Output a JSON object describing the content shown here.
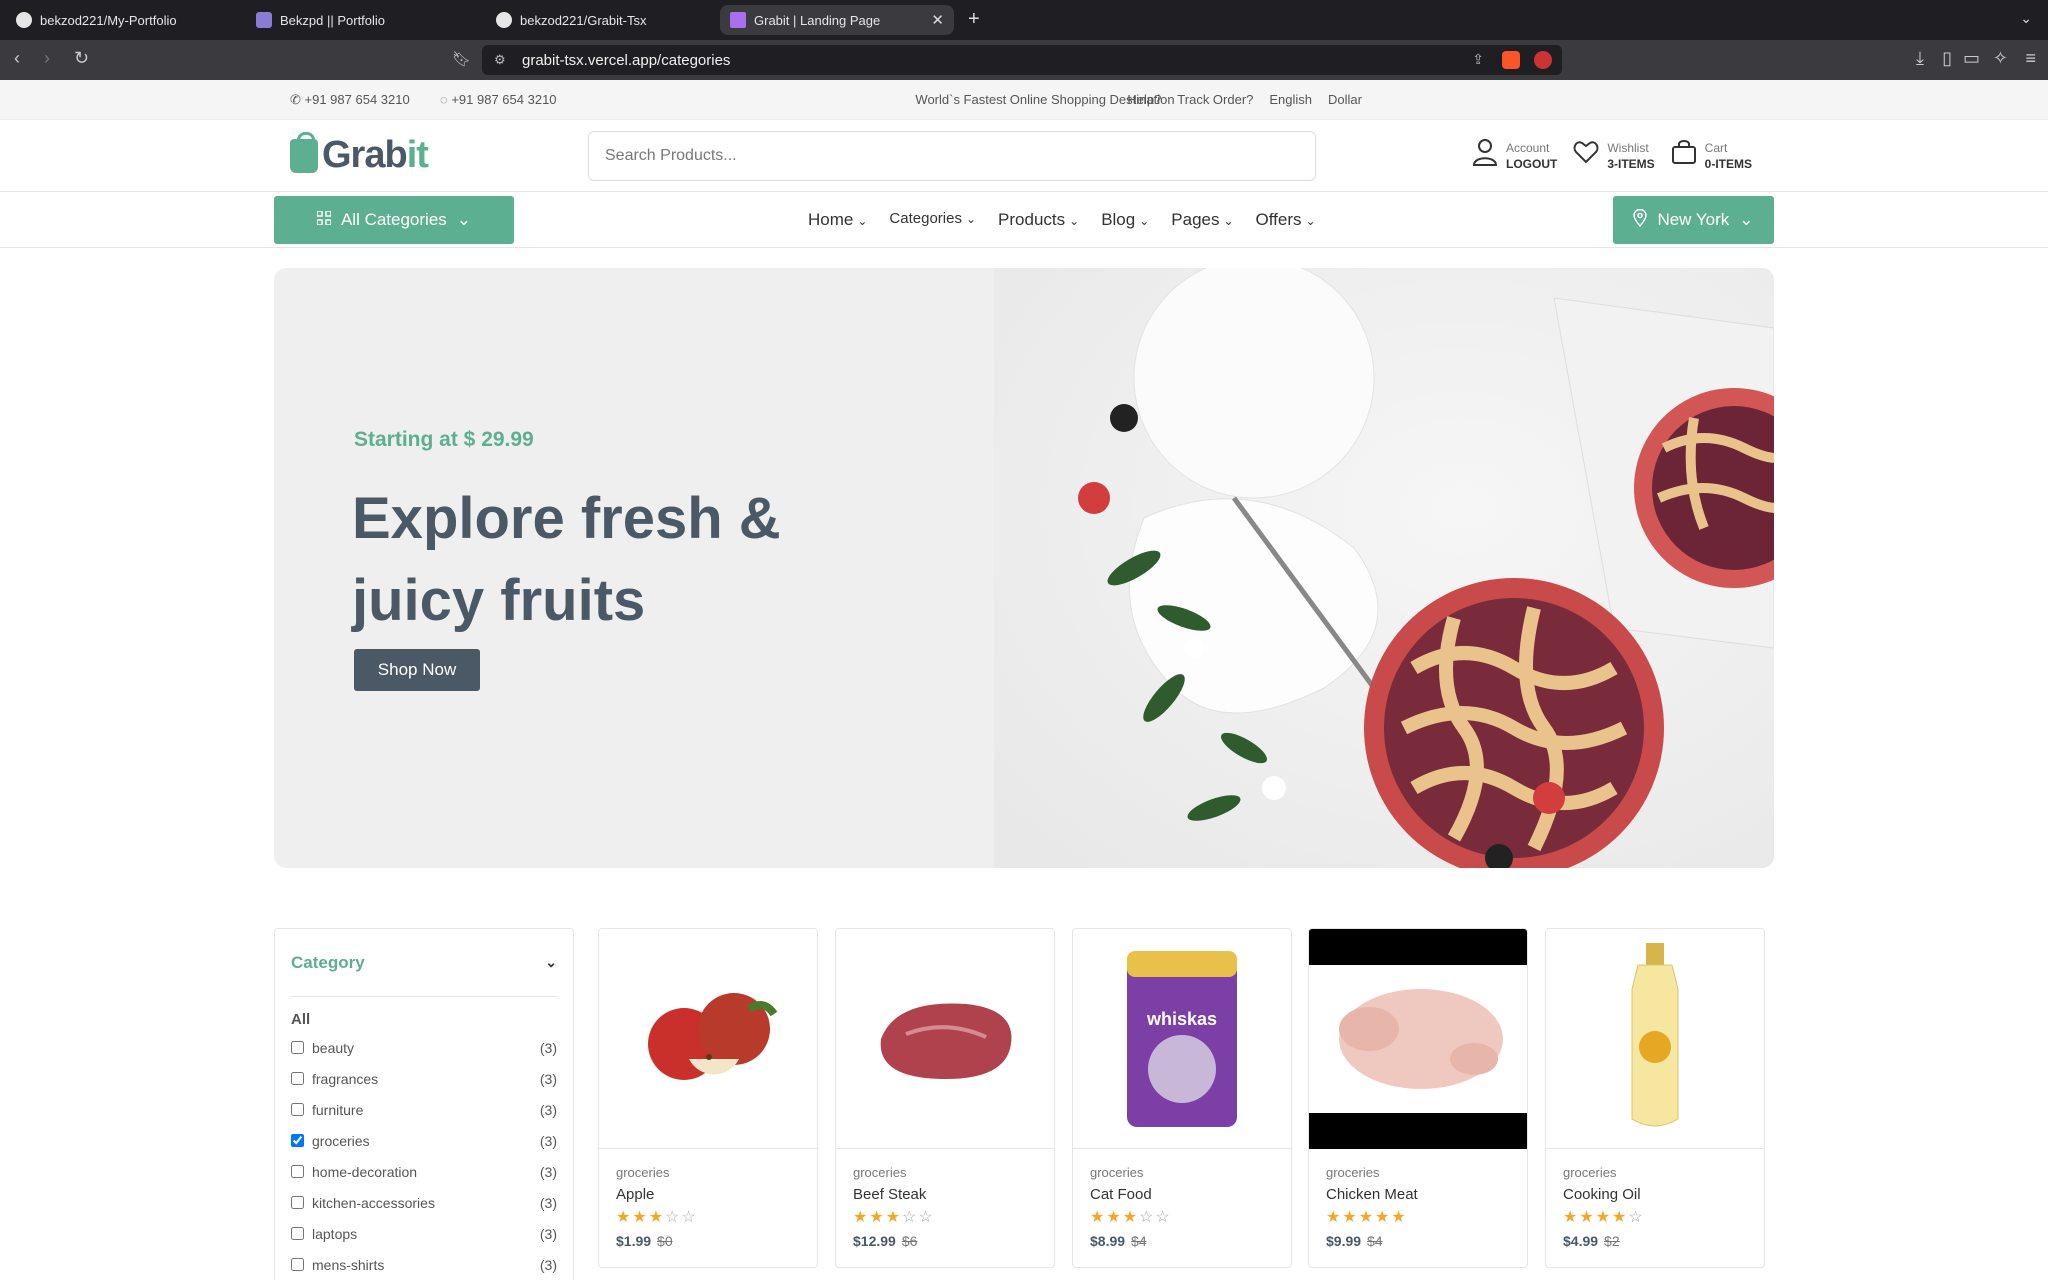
{
  "browser": {
    "tabs": [
      {
        "title": "bekzod221/My-Portfolio"
      },
      {
        "title": "Bekzpd || Portfolio"
      },
      {
        "title": "bekzod221/Grabit-Tsx"
      },
      {
        "title": "Grabit | Landing Page"
      }
    ],
    "url": "grabit-tsx.vercel.app/categories"
  },
  "topstrip": {
    "phone1": "+91 987 654 3210",
    "phone2": "+91 987 654 3210",
    "tagline": "World`s Fastest Online Shopping Destination",
    "links": [
      "Help?",
      "Track Order?",
      "English",
      "Dollar"
    ]
  },
  "header": {
    "logo_text_a": "Grab",
    "logo_text_b": "it",
    "search_placeholder": "Search Products...",
    "account": {
      "label": "Account",
      "value": "LOGOUT"
    },
    "wishlist": {
      "label": "Wishlist",
      "value": "3-ITEMS"
    },
    "cart": {
      "label": "Cart",
      "value": "0-ITEMS"
    }
  },
  "nav": {
    "all_categories": "All Categories",
    "links": [
      "Home",
      "Categories",
      "Products",
      "Blog",
      "Pages",
      "Offers"
    ],
    "city": "New York"
  },
  "hero": {
    "subtitle": "Starting at $ 29.99",
    "title": "Explore fresh & juicy fruits",
    "button": "Shop Now"
  },
  "sidebar": {
    "heading": "Category",
    "all": "All",
    "items": [
      {
        "label": "beauty",
        "count": "(3)",
        "checked": false
      },
      {
        "label": "fragrances",
        "count": "(3)",
        "checked": false
      },
      {
        "label": "furniture",
        "count": "(3)",
        "checked": false
      },
      {
        "label": "groceries",
        "count": "(3)",
        "checked": true
      },
      {
        "label": "home-decoration",
        "count": "(3)",
        "checked": false
      },
      {
        "label": "kitchen-accessories",
        "count": "(3)",
        "checked": false
      },
      {
        "label": "laptops",
        "count": "(3)",
        "checked": false
      },
      {
        "label": "mens-shirts",
        "count": "(3)",
        "checked": false
      }
    ]
  },
  "products": [
    {
      "category": "groceries",
      "name": "Apple",
      "rating": 3,
      "price": "$1.99",
      "old_price": "$0"
    },
    {
      "category": "groceries",
      "name": "Beef Steak",
      "rating": 3,
      "price": "$12.99",
      "old_price": "$6"
    },
    {
      "category": "groceries",
      "name": "Cat Food",
      "rating": 3,
      "price": "$8.99",
      "old_price": "$4"
    },
    {
      "category": "groceries",
      "name": "Chicken Meat",
      "rating": 5,
      "price": "$9.99",
      "old_price": "$4"
    },
    {
      "category": "groceries",
      "name": "Cooking Oil",
      "rating": 4,
      "price": "$4.99",
      "old_price": "$2"
    }
  ],
  "product_image_text": {
    "whiskas": "whiskas"
  },
  "colors": {
    "accent": "#5caf90",
    "dark": "#4b5966",
    "star": "#f5a623"
  }
}
